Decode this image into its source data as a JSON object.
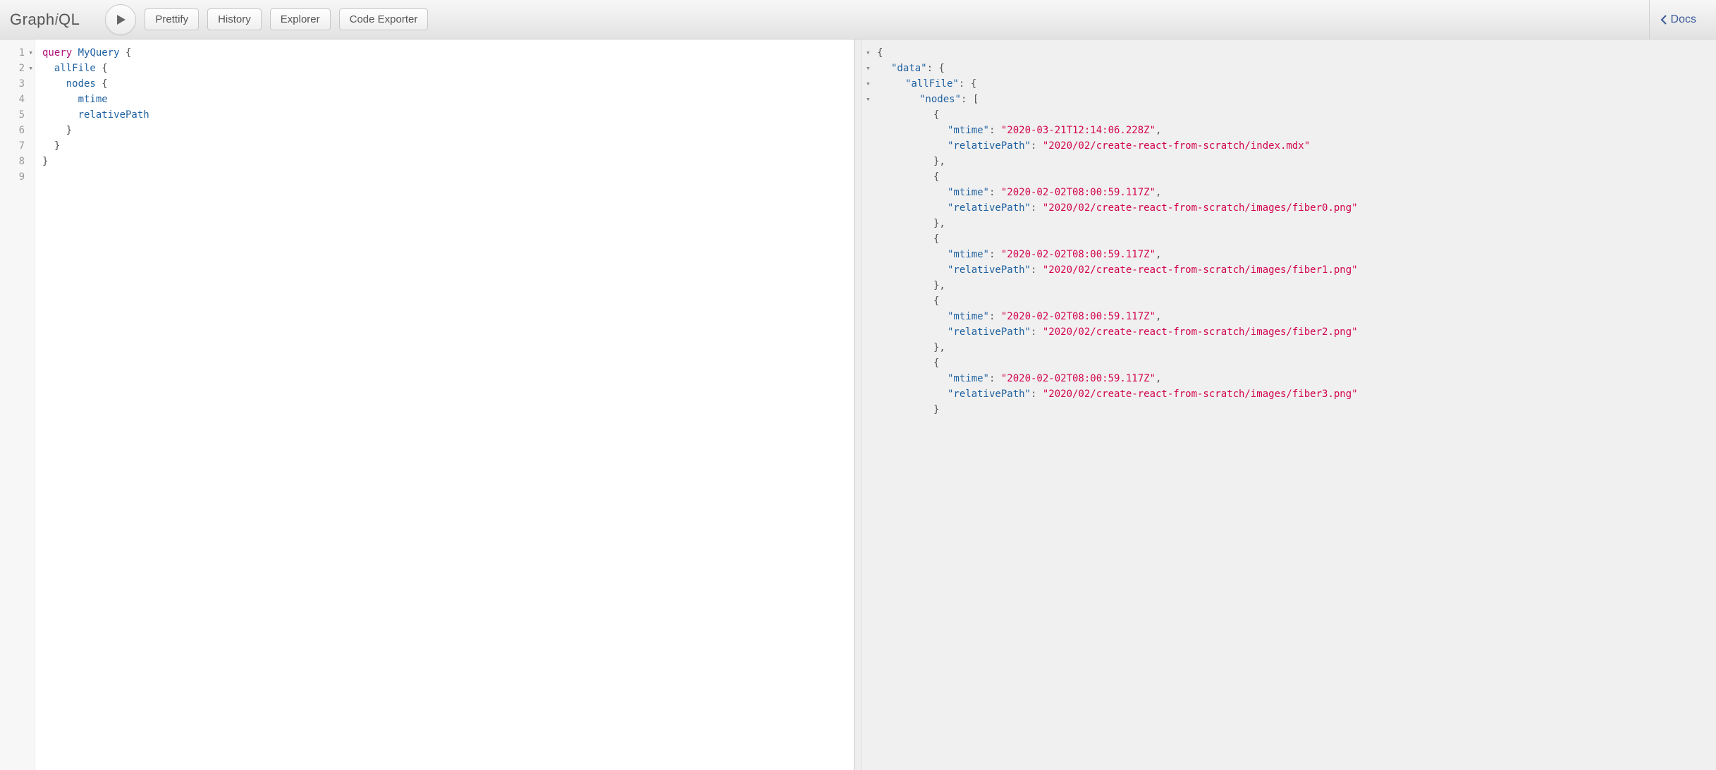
{
  "app": {
    "title_plain_prefix": "Graph",
    "title_ital": "i",
    "title_plain_suffix": "QL"
  },
  "toolbar": {
    "prettify": "Prettify",
    "history": "History",
    "explorer": "Explorer",
    "code_exporter": "Code Exporter",
    "docs": "Docs"
  },
  "editor": {
    "line_numbers": [
      "1",
      "2",
      "3",
      "4",
      "5",
      "6",
      "7",
      "8",
      "9"
    ],
    "fold_lines": [
      0,
      1
    ],
    "tokens": [
      {
        "kw": "query",
        "def": "MyQuery",
        "tail": " {"
      },
      {
        "indent": 1,
        "attr": "allFile",
        "tail": " {"
      },
      {
        "indent": 2,
        "attr": "nodes",
        "tail": " {"
      },
      {
        "indent": 3,
        "attr": "mtime"
      },
      {
        "indent": 3,
        "attr": "relativePath"
      },
      {
        "indent": 2,
        "punc": "}"
      },
      {
        "indent": 1,
        "punc": "}"
      },
      {
        "punc": "}"
      },
      {
        "punc": ""
      }
    ]
  },
  "result": {
    "data_key": "data",
    "allFile_key": "allFile",
    "nodes_key": "nodes",
    "mtime_key": "mtime",
    "relativePath_key": "relativePath",
    "nodes": [
      {
        "mtime": "2020-03-21T12:14:06.228Z",
        "relativePath": "2020/02/create-react-from-scratch/index.mdx"
      },
      {
        "mtime": "2020-02-02T08:00:59.117Z",
        "relativePath": "2020/02/create-react-from-scratch/images/fiber0.png"
      },
      {
        "mtime": "2020-02-02T08:00:59.117Z",
        "relativePath": "2020/02/create-react-from-scratch/images/fiber1.png"
      },
      {
        "mtime": "2020-02-02T08:00:59.117Z",
        "relativePath": "2020/02/create-react-from-scratch/images/fiber2.png"
      },
      {
        "mtime": "2020-02-02T08:00:59.117Z",
        "relativePath": "2020/02/create-react-from-scratch/images/fiber3.png"
      }
    ]
  }
}
